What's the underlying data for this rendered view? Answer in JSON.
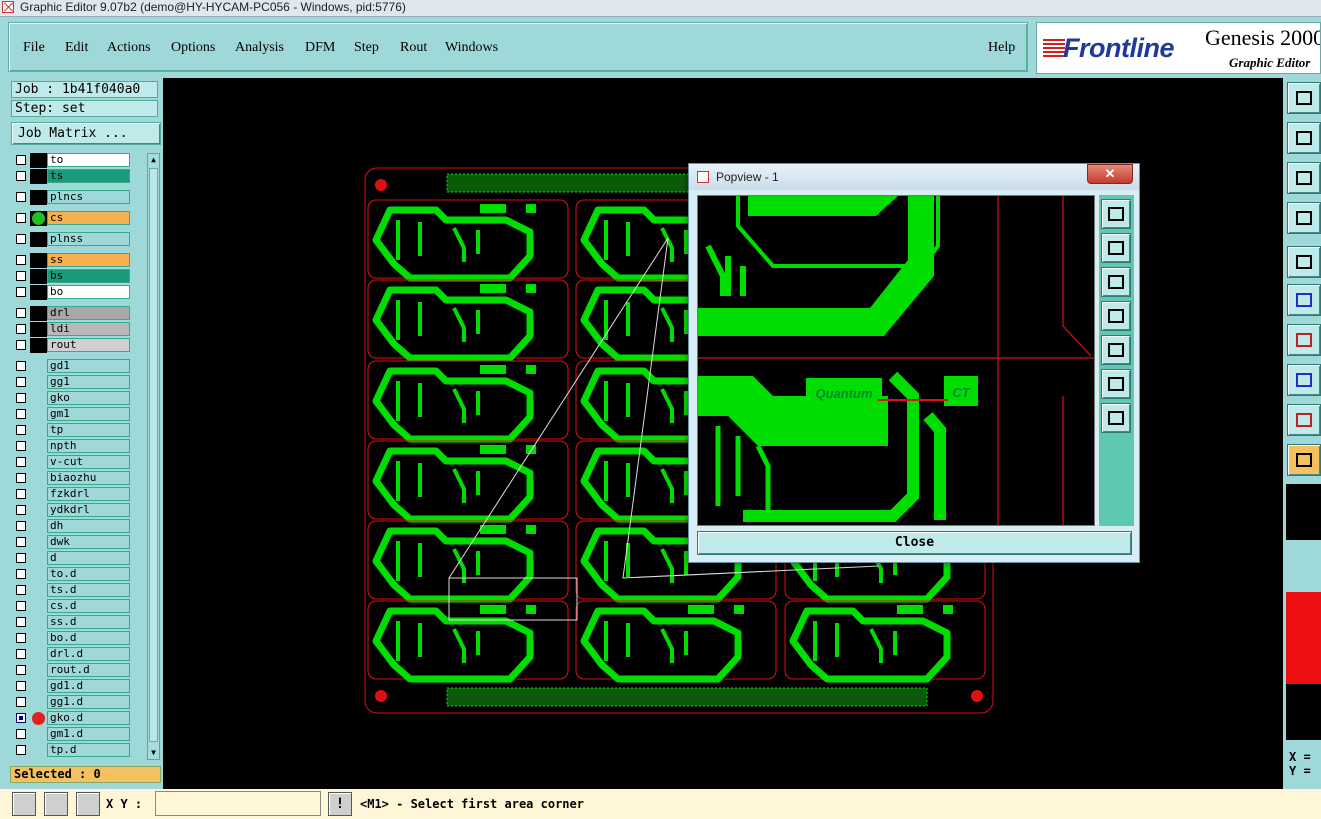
{
  "window": {
    "title": "Graphic Editor 9.07b2 (demo@HY-HYCAM-PC056 - Windows, pid:5776)"
  },
  "menu": {
    "items": [
      "File",
      "Edit",
      "Actions",
      "Options",
      "Analysis",
      "DFM",
      "Step",
      "Rout",
      "Windows"
    ],
    "help": "Help"
  },
  "logo": {
    "brand": "Frontline",
    "product": "Genesis 2000",
    "subtitle": "Graphic Editor"
  },
  "job": {
    "job_label": "Job : 1b41f040a0",
    "step_label": "Step: set",
    "matrix_button": "Job Matrix ..."
  },
  "layers": [
    {
      "name": "to",
      "color": "#ffffff",
      "dot": ""
    },
    {
      "name": "ts",
      "color": "#1a9a7a",
      "dot": ""
    },
    {
      "name": "plncs",
      "color": "#9fd8d8",
      "dot": ""
    },
    {
      "name": "cs",
      "color": "#f5b050",
      "dot": "#20c020"
    },
    {
      "name": "plnss",
      "color": "#9fd8d8",
      "dot": ""
    },
    {
      "name": "ss",
      "color": "#f5b050",
      "dot": ""
    },
    {
      "name": "bs",
      "color": "#1a9a7a",
      "dot": ""
    },
    {
      "name": "bo",
      "color": "#ffffff",
      "dot": ""
    },
    {
      "name": "drl",
      "color": "#a8a8a8",
      "dot": ""
    },
    {
      "name": "ldi",
      "color": "#b8b8b8",
      "dot": ""
    },
    {
      "name": "rout",
      "color": "#d0d0d0",
      "dot": ""
    },
    {
      "name": "gd1",
      "color": "#9fd8d8",
      "dot": ""
    },
    {
      "name": "gg1",
      "color": "#9fd8d8",
      "dot": ""
    },
    {
      "name": "gko",
      "color": "#9fd8d8",
      "dot": ""
    },
    {
      "name": "gm1",
      "color": "#9fd8d8",
      "dot": ""
    },
    {
      "name": "tp",
      "color": "#9fd8d8",
      "dot": ""
    },
    {
      "name": "npth",
      "color": "#9fd8d8",
      "dot": ""
    },
    {
      "name": "v-cut",
      "color": "#9fd8d8",
      "dot": ""
    },
    {
      "name": "biaozhu",
      "color": "#9fd8d8",
      "dot": ""
    },
    {
      "name": "fzkdrl",
      "color": "#9fd8d8",
      "dot": ""
    },
    {
      "name": "ydkdrl",
      "color": "#9fd8d8",
      "dot": ""
    },
    {
      "name": "dh",
      "color": "#9fd8d8",
      "dot": ""
    },
    {
      "name": "dwk",
      "color": "#9fd8d8",
      "dot": ""
    },
    {
      "name": "d",
      "color": "#9fd8d8",
      "dot": ""
    },
    {
      "name": "to.d",
      "color": "#9fd8d8",
      "dot": ""
    },
    {
      "name": "ts.d",
      "color": "#9fd8d8",
      "dot": ""
    },
    {
      "name": "cs.d",
      "color": "#9fd8d8",
      "dot": ""
    },
    {
      "name": "ss.d",
      "color": "#9fd8d8",
      "dot": ""
    },
    {
      "name": "bo.d",
      "color": "#9fd8d8",
      "dot": ""
    },
    {
      "name": "drl.d",
      "color": "#9fd8d8",
      "dot": ""
    },
    {
      "name": "rout.d",
      "color": "#9fd8d8",
      "dot": ""
    },
    {
      "name": "gd1.d",
      "color": "#9fd8d8",
      "dot": ""
    },
    {
      "name": "gg1.d",
      "color": "#9fd8d8",
      "dot": ""
    },
    {
      "name": "gko.d",
      "color": "#9fd8d8",
      "dot": "#e02020"
    },
    {
      "name": "gm1.d",
      "color": "#9fd8d8",
      "dot": ""
    },
    {
      "name": "tp.d",
      "color": "#9fd8d8",
      "dot": ""
    }
  ],
  "selected": "Selected : 0",
  "board": {
    "part_label": "Quantum",
    "ct_label": "CT",
    "copper": "#00dd00",
    "outline": "#dd1111"
  },
  "popview": {
    "title": "Popview - 1",
    "close_x": "✕",
    "close_button": "Close",
    "view_label_1": "Quantum",
    "view_label_2": "CT"
  },
  "status": {
    "xy_label": "X Y :",
    "xy_value": "",
    "prompt": "<M1> - Select first area corner",
    "right_x": "X =",
    "right_y": "Y ="
  }
}
